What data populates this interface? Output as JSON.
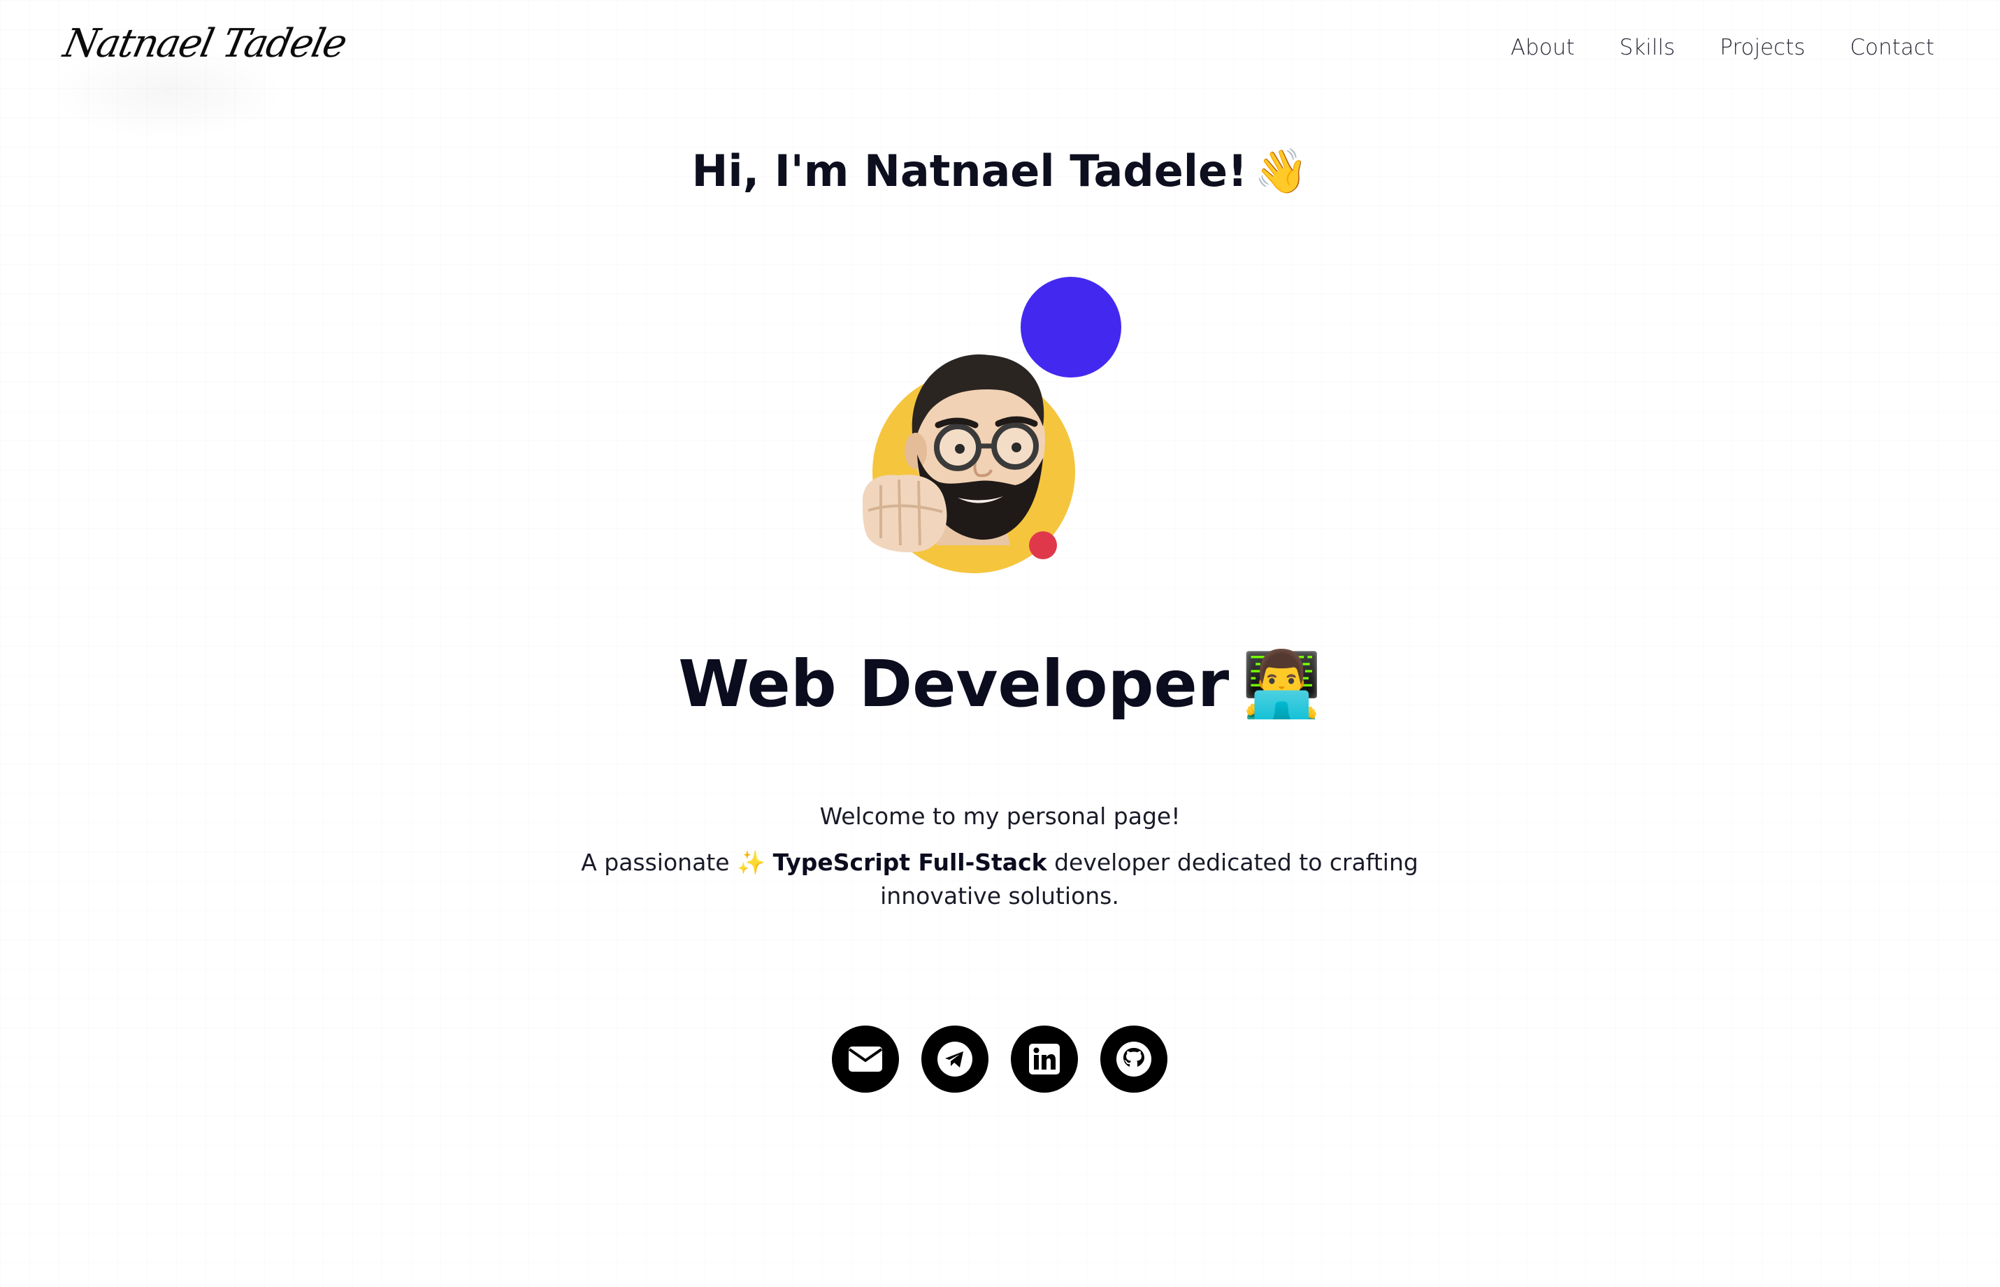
{
  "header": {
    "logo_text": "Natnael Tadele",
    "nav": [
      {
        "label": "About"
      },
      {
        "label": "Skills"
      },
      {
        "label": "Projects"
      },
      {
        "label": "Contact"
      }
    ]
  },
  "hero": {
    "greeting": "Hi, I'm Natnael Tadele!",
    "greeting_emoji": "👋",
    "role": "Web Developer",
    "role_emoji": "👨‍💻",
    "welcome": "Welcome to my personal page!",
    "desc_prefix": "A passionate",
    "desc_emoji": "✨",
    "desc_bold": "TypeScript Full-Stack",
    "desc_suffix": "developer dedicated to crafting innovative solutions."
  },
  "avatar": {
    "icon": "memoji-avatar",
    "colors": {
      "blue_dot": "#4329f0",
      "yellow_circle": "#f5c53e",
      "red_dot": "#e0384b"
    }
  },
  "socials": [
    {
      "icon": "email-icon"
    },
    {
      "icon": "telegram-icon"
    },
    {
      "icon": "linkedin-icon"
    },
    {
      "icon": "github-icon"
    }
  ]
}
